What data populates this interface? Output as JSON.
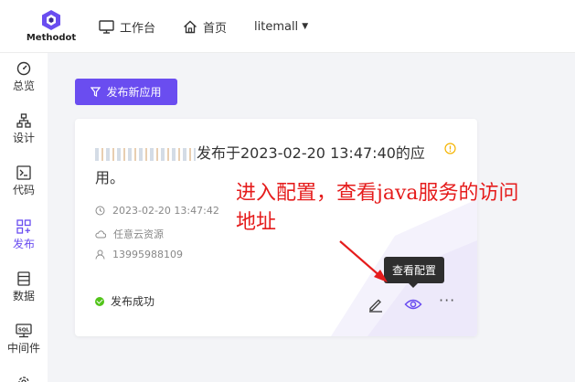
{
  "header": {
    "logo_text": "Methodot",
    "nav": [
      {
        "label": "工作台",
        "icon": "monitor-icon"
      },
      {
        "label": "首页",
        "icon": "home-icon"
      },
      {
        "label": "litemall",
        "icon": "caret-down-icon"
      }
    ]
  },
  "sidebar": {
    "items": [
      {
        "label": "总览",
        "icon": "dashboard-icon"
      },
      {
        "label": "设计",
        "icon": "structure-icon"
      },
      {
        "label": "代码",
        "icon": "terminal-icon"
      },
      {
        "label": "发布",
        "icon": "apps-icon",
        "active": true
      },
      {
        "label": "数据",
        "icon": "database-icon"
      },
      {
        "label": "中间件",
        "icon": "sql-icon"
      }
    ]
  },
  "toolbar": {
    "publish_label": "发布新应用"
  },
  "card": {
    "title_rest": "发布于2023-02-20 13:47:40的应用。",
    "time": "2023-02-20 13:47:42",
    "resource": "任意云资源",
    "user": "13995988109",
    "status": "发布成功",
    "tooltip": "查看配置"
  },
  "annotation": {
    "text": "进入配置，查看java服务的访问地址"
  },
  "colors": {
    "accent": "#6a4df0",
    "success": "#52c41a",
    "annotation": "#e51c1c",
    "warning": "#f5b400"
  }
}
